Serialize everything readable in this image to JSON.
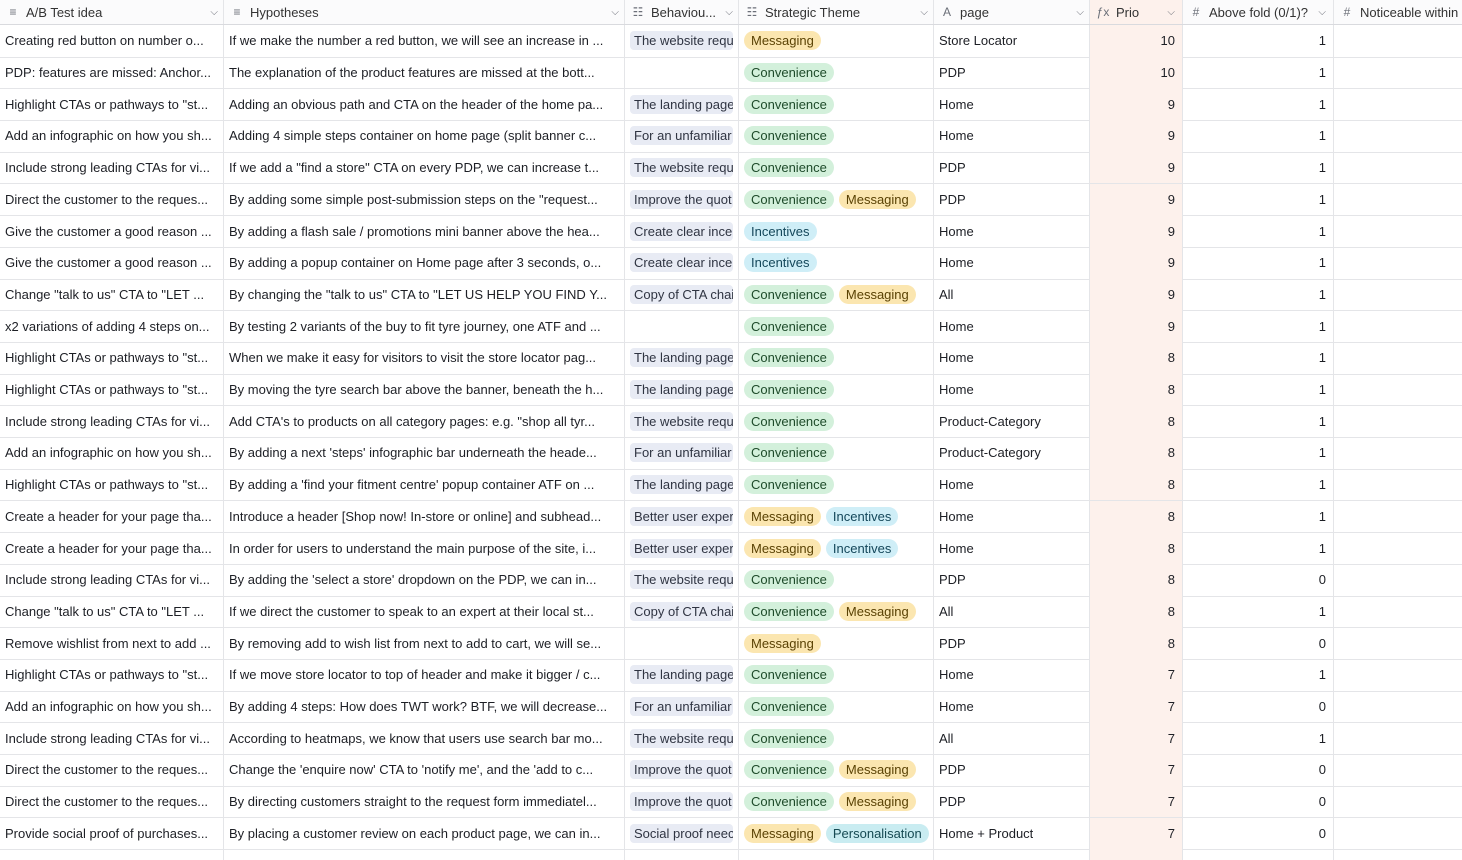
{
  "headers": [
    {
      "label": "A/B Test idea",
      "icon": "≡"
    },
    {
      "label": "Hypotheses",
      "icon": "≡"
    },
    {
      "label": "Behaviou...",
      "icon": "☷"
    },
    {
      "label": "Strategic Theme",
      "icon": "☷"
    },
    {
      "label": "page",
      "icon": "A"
    },
    {
      "label": "Prio",
      "icon": "ƒx"
    },
    {
      "label": "Above fold (0/1)?",
      "icon": "#"
    },
    {
      "label": "Noticeable within",
      "icon": "#"
    }
  ],
  "colors": {
    "convenience": "#d3f0db",
    "messaging": "#fbe6b0",
    "incentives": "#cfeef7",
    "personalisation": "#c9ecf1",
    "prio_bg": "#fdf1ec"
  },
  "rows": [
    {
      "idea": "Creating red button on number o...",
      "hyp": "If we make the number a red button, we will see an increase in ...",
      "beh": "The website requ",
      "themes": [
        "Messaging"
      ],
      "page": "Store Locator",
      "prio": "10",
      "fold": "1"
    },
    {
      "idea": "PDP: features are missed: Anchor...",
      "hyp": "The explanation of the product features are missed at the bott...",
      "beh": "",
      "themes": [
        "Convenience"
      ],
      "page": "PDP",
      "prio": "10",
      "fold": "1"
    },
    {
      "idea": "Highlight CTAs or pathways to \"st...",
      "hyp": "Adding an obvious path and CTA on the header of the home pa...",
      "beh": "The landing page",
      "themes": [
        "Convenience"
      ],
      "page": "Home",
      "prio": "9",
      "fold": "1"
    },
    {
      "idea": "Add an infographic on how you sh...",
      "hyp": "Adding 4 simple steps container on home page (split banner c...",
      "beh": "For an unfamiliar",
      "themes": [
        "Convenience"
      ],
      "page": "Home",
      "prio": "9",
      "fold": "1"
    },
    {
      "idea": "Include strong leading CTAs for vi...",
      "hyp": "If we add a \"find a store\" CTA on every PDP, we can increase t...",
      "beh": "The website requ",
      "themes": [
        "Convenience"
      ],
      "page": "PDP",
      "prio": "9",
      "fold": "1"
    },
    {
      "idea": "Direct the customer to the reques...",
      "hyp": "By adding some simple post-submission steps on the \"request...",
      "beh": "Improve the quot",
      "themes": [
        "Convenience",
        "Messaging"
      ],
      "page": "PDP",
      "prio": "9",
      "fold": "1"
    },
    {
      "idea": "Give the customer a good reason ...",
      "hyp": "By adding a flash sale / promotions mini banner above the hea...",
      "beh": "Create clear ince",
      "themes": [
        "Incentives"
      ],
      "page": "Home",
      "prio": "9",
      "fold": "1"
    },
    {
      "idea": "Give the customer a good reason ...",
      "hyp": "By adding a popup container on Home page after 3 seconds, o...",
      "beh": "Create clear ince",
      "themes": [
        "Incentives"
      ],
      "page": "Home",
      "prio": "9",
      "fold": "1"
    },
    {
      "idea": "Change \"talk to us\" CTA to \"LET ...",
      "hyp": "By changing the \"talk to us\" CTA to \"LET US HELP YOU FIND Y...",
      "beh": "Copy of CTA chai",
      "themes": [
        "Convenience",
        "Messaging"
      ],
      "page": "All",
      "prio": "9",
      "fold": "1"
    },
    {
      "idea": "x2 variations of adding 4 steps on...",
      "hyp": "By testing 2 variants of the buy to fit tyre journey, one ATF and ...",
      "beh": "",
      "themes": [
        "Convenience"
      ],
      "page": "Home",
      "prio": "9",
      "fold": "1"
    },
    {
      "idea": "Highlight CTAs or pathways to \"st...",
      "hyp": "When we make it easy for visitors to visit the store locator pag...",
      "beh": "The landing page",
      "themes": [
        "Convenience"
      ],
      "page": "Home",
      "prio": "8",
      "fold": "1"
    },
    {
      "idea": "Highlight CTAs or pathways to \"st...",
      "hyp": "By moving the tyre search bar above the banner, beneath the h...",
      "beh": "The landing page",
      "themes": [
        "Convenience"
      ],
      "page": "Home",
      "prio": "8",
      "fold": "1"
    },
    {
      "idea": "Include strong leading CTAs for vi...",
      "hyp": "Add CTA's to products on all category pages: e.g. \"shop all tyr...",
      "beh": "The website requ",
      "themes": [
        "Convenience"
      ],
      "page": "Product-Category",
      "prio": "8",
      "fold": "1"
    },
    {
      "idea": "Add an infographic on how you sh...",
      "hyp": "By adding a next 'steps' infographic bar underneath the heade...",
      "beh": "For an unfamiliar",
      "themes": [
        "Convenience"
      ],
      "page": "Product-Category",
      "prio": "8",
      "fold": "1"
    },
    {
      "idea": "Highlight CTAs or pathways to \"st...",
      "hyp": "By adding a 'find your fitment centre' popup container ATF on ...",
      "beh": "The landing page",
      "themes": [
        "Convenience"
      ],
      "page": "Home",
      "prio": "8",
      "fold": "1"
    },
    {
      "idea": "Create a header for your page tha...",
      "hyp": "Introduce a header [Shop now! In-store or online] and subhead...",
      "beh": "Better user exper",
      "themes": [
        "Messaging",
        "Incentives"
      ],
      "page": "Home",
      "prio": "8",
      "fold": "1"
    },
    {
      "idea": "Create a header for your page tha...",
      "hyp": "In order for users to understand the main purpose of the site, i...",
      "beh": "Better user exper",
      "themes": [
        "Messaging",
        "Incentives"
      ],
      "page": "Home",
      "prio": "8",
      "fold": "1"
    },
    {
      "idea": "Include strong leading CTAs for vi...",
      "hyp": "By adding the 'select a store' dropdown on the PDP, we can in...",
      "beh": "The website requ",
      "themes": [
        "Convenience"
      ],
      "page": "PDP",
      "prio": "8",
      "fold": "0"
    },
    {
      "idea": "Change \"talk to us\" CTA to \"LET ...",
      "hyp": "If we direct the customer to speak to an expert at their local st...",
      "beh": "Copy of CTA chai",
      "themes": [
        "Convenience",
        "Messaging"
      ],
      "page": "All",
      "prio": "8",
      "fold": "1"
    },
    {
      "idea": "Remove wishlist from next to add ...",
      "hyp": "By removing add to wish list from next to add to cart, we will se...",
      "beh": "",
      "themes": [
        "Messaging"
      ],
      "page": "PDP",
      "prio": "8",
      "fold": "0"
    },
    {
      "idea": "Highlight CTAs or pathways to \"st...",
      "hyp": "If we move store locator to top of header and make it bigger / c...",
      "beh": "The landing page",
      "themes": [
        "Convenience"
      ],
      "page": "Home",
      "prio": "7",
      "fold": "1"
    },
    {
      "idea": "Add an infographic on how you sh...",
      "hyp": "By adding 4 steps: How does TWT work? BTF, we will decrease...",
      "beh": "For an unfamiliar",
      "themes": [
        "Convenience"
      ],
      "page": "Home",
      "prio": "7",
      "fold": "0"
    },
    {
      "idea": "Include strong leading CTAs for vi...",
      "hyp": "According to heatmaps, we know that users use search bar mo...",
      "beh": "The website requ",
      "themes": [
        "Convenience"
      ],
      "page": "All",
      "prio": "7",
      "fold": "1"
    },
    {
      "idea": "Direct the customer to the reques...",
      "hyp": "Change the 'enquire now' CTA to 'notify me', and the 'add to c...",
      "beh": "Improve the quot",
      "themes": [
        "Convenience",
        "Messaging"
      ],
      "page": "PDP",
      "prio": "7",
      "fold": "0"
    },
    {
      "idea": "Direct the customer to the reques...",
      "hyp": "By directing customers straight to the request form immediatel...",
      "beh": "Improve the quot",
      "themes": [
        "Convenience",
        "Messaging"
      ],
      "page": "PDP",
      "prio": "7",
      "fold": "0"
    },
    {
      "idea": "Provide social proof of purchases...",
      "hyp": "By placing a customer review on each product page, we can in...",
      "beh": "Social proof neec",
      "themes": [
        "Messaging",
        "Personalisation"
      ],
      "page": "Home + Product",
      "prio": "7",
      "fold": "0"
    }
  ]
}
